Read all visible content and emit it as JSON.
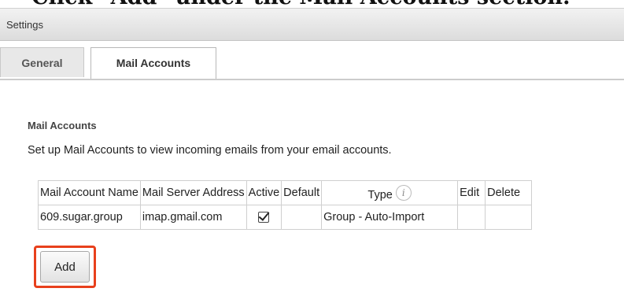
{
  "caption": "Click \"Add\" under the Mail Accounts section.",
  "settings_bar": {
    "title": "Settings"
  },
  "tabs": [
    {
      "label": "General",
      "active": false
    },
    {
      "label": "Mail Accounts",
      "active": true
    }
  ],
  "section": {
    "title": "Mail Accounts",
    "description": "Set up Mail Accounts to view incoming emails from your email accounts."
  },
  "table": {
    "columns": [
      "Mail Account Name",
      "Mail Server Address",
      "Active",
      "Default",
      "Type",
      "Edit",
      "Delete"
    ],
    "rows": [
      {
        "account_name": "609.sugar.group",
        "server_address": "imap.gmail.com",
        "active": true,
        "default": "",
        "type": "Group - Auto-Import",
        "edit": "",
        "delete": ""
      }
    ]
  },
  "add_button": {
    "label": "Add"
  },
  "colors": {
    "highlight": "#e8401c",
    "tab_border": "#cccccc"
  }
}
